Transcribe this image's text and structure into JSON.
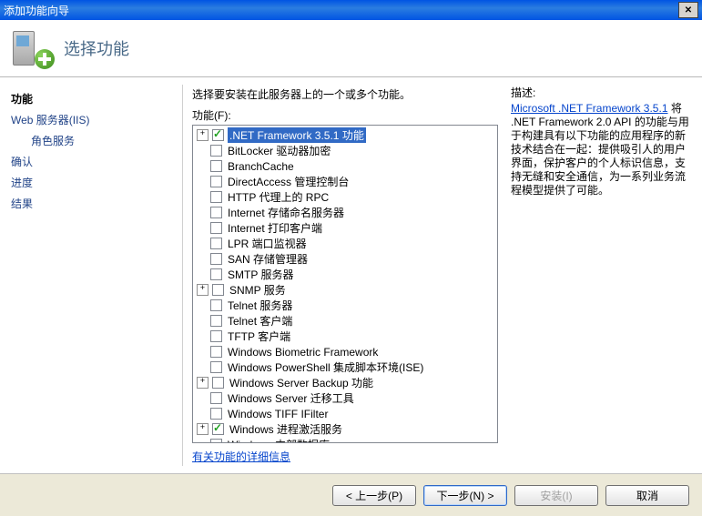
{
  "title": "添加功能向导",
  "banner_title": "选择功能",
  "sidebar": {
    "items": [
      {
        "label": "功能",
        "current": true
      },
      {
        "label": "Web 服务器(IIS)"
      },
      {
        "label": "角色服务",
        "indent": true
      },
      {
        "label": "确认"
      },
      {
        "label": "进度"
      },
      {
        "label": "结果"
      }
    ]
  },
  "main": {
    "instruction": "选择要安装在此服务器上的一个或多个功能。",
    "features_label": "功能(F):",
    "more_link": "有关功能的详细信息",
    "features": [
      {
        "label": ".NET Framework 3.5.1 功能",
        "checked": true,
        "expandable": true,
        "selected": true
      },
      {
        "label": "BitLocker 驱动器加密"
      },
      {
        "label": "BranchCache"
      },
      {
        "label": "DirectAccess 管理控制台"
      },
      {
        "label": "HTTP 代理上的 RPC"
      },
      {
        "label": "Internet 存储命名服务器"
      },
      {
        "label": "Internet 打印客户端"
      },
      {
        "label": "LPR 端口监视器"
      },
      {
        "label": "SAN 存储管理器"
      },
      {
        "label": "SMTP 服务器"
      },
      {
        "label": "SNMP 服务",
        "expandable": true
      },
      {
        "label": "Telnet 服务器"
      },
      {
        "label": "Telnet 客户端"
      },
      {
        "label": "TFTP 客户端"
      },
      {
        "label": "Windows Biometric Framework"
      },
      {
        "label": "Windows PowerShell 集成脚本环境(ISE)"
      },
      {
        "label": "Windows Server Backup 功能",
        "expandable": true
      },
      {
        "label": "Windows Server 迁移工具"
      },
      {
        "label": "Windows TIFF IFilter"
      },
      {
        "label": "Windows 进程激活服务",
        "checked": true,
        "expandable": true
      },
      {
        "label": "Windows 内部数据库"
      }
    ]
  },
  "desc": {
    "label": "描述:",
    "link": "Microsoft .NET Framework 3.5.1",
    "text": "将 .NET Framework 2.0 API 的功能与用于构建具有以下功能的应用程序的新技术结合在一起：提供吸引人的用户界面，保护客户的个人标识信息，支持无缝和安全通信，为一系列业务流程模型提供了可能。"
  },
  "buttons": {
    "prev": "< 上一步(P)",
    "next": "下一步(N) >",
    "install": "安装(I)",
    "cancel": "取消"
  }
}
